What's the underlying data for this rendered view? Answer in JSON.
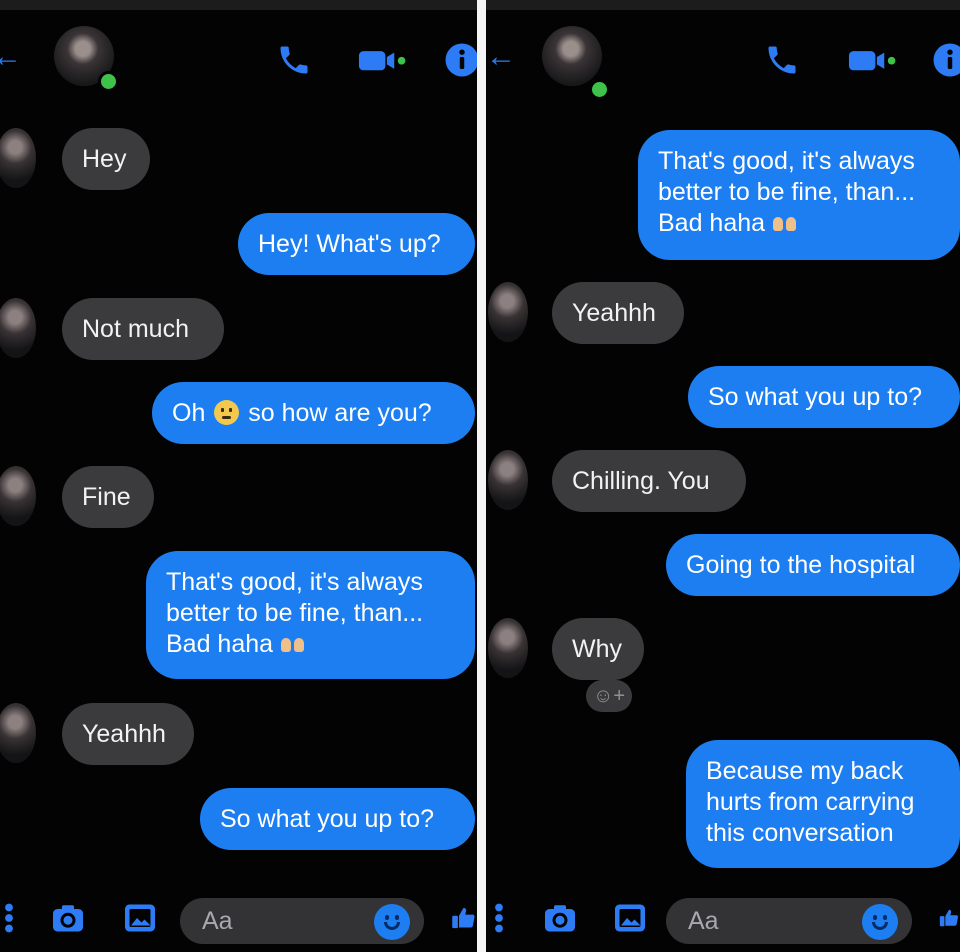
{
  "colors": {
    "accent": "#1d7ef2",
    "incoming_bubble": "#3b3b3d",
    "background": "#030304",
    "online": "#3fc24a"
  },
  "icons": [
    "back-arrow-icon",
    "phone-icon",
    "video-icon",
    "info-icon",
    "menu-dots-icon",
    "camera-icon",
    "image-icon",
    "smiley-icon",
    "like-icon"
  ],
  "left": {
    "messages": {
      "m1": "Hey",
      "m2": "Hey! What's up?",
      "m3": "Not much",
      "m4a": "Oh",
      "m4b": "so how are you?",
      "m5": "Fine",
      "m6l1": "That's good, it's always",
      "m6l2": "better to be fine, than...",
      "m6l3": "Bad haha",
      "m7": "Yeahhh",
      "m8": "So what you up to?"
    },
    "composer_placeholder": "Aa"
  },
  "right": {
    "messages": {
      "m1l1": "That's good, it's always",
      "m1l2": "better to be fine, than...",
      "m1l3": "Bad haha",
      "m2": "Yeahhh",
      "m3": "So what you up to?",
      "m4": "Chilling. You",
      "m5": "Going to the hospital",
      "m6": "Why",
      "m7l1": "Because my back",
      "m7l2": "hurts from carrying",
      "m7l3": "this conversation"
    },
    "composer_placeholder": "Aa"
  }
}
